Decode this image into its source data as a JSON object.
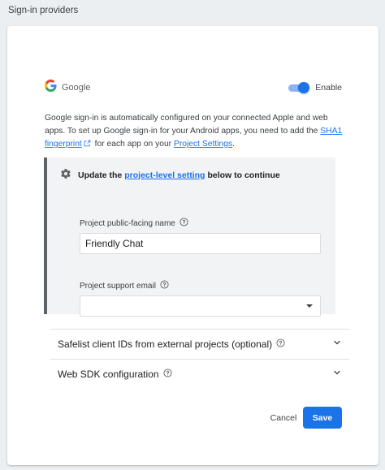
{
  "header": {
    "title": "Sign-in providers"
  },
  "provider": {
    "name": "Google",
    "enabled": true,
    "toggle_label": "Enable"
  },
  "description": {
    "line1": "Google sign-in is automatically configured on your connected Apple and web apps. To set up Google sign-in for your Android apps, you need to add the ",
    "sha1_link": "SHA1 fingerprint",
    "middle": " for each app on your ",
    "settings_link": "Project Settings",
    "end": "."
  },
  "info_box": {
    "prefix": "Update the",
    "link": "project-level setting",
    "suffix": "below to continue",
    "public_name_label": "Project public-facing name",
    "public_name_value": "Friendly Chat",
    "support_email_label": "Project support email",
    "support_email_value": ""
  },
  "sections": [
    {
      "label": "Safelist client IDs from external projects (optional)"
    },
    {
      "label": "Web SDK configuration"
    }
  ],
  "actions": {
    "cancel": "Cancel",
    "save": "Save"
  },
  "colors": {
    "primary": "#1a73e8",
    "toggle_track": "#8ab4f8",
    "info_bg": "#f1f3f4",
    "info_border": "#5f6368"
  },
  "icons": [
    "google-logo-icon",
    "external-link-icon",
    "gear-icon",
    "help-icon",
    "chevron-down-icon"
  ]
}
